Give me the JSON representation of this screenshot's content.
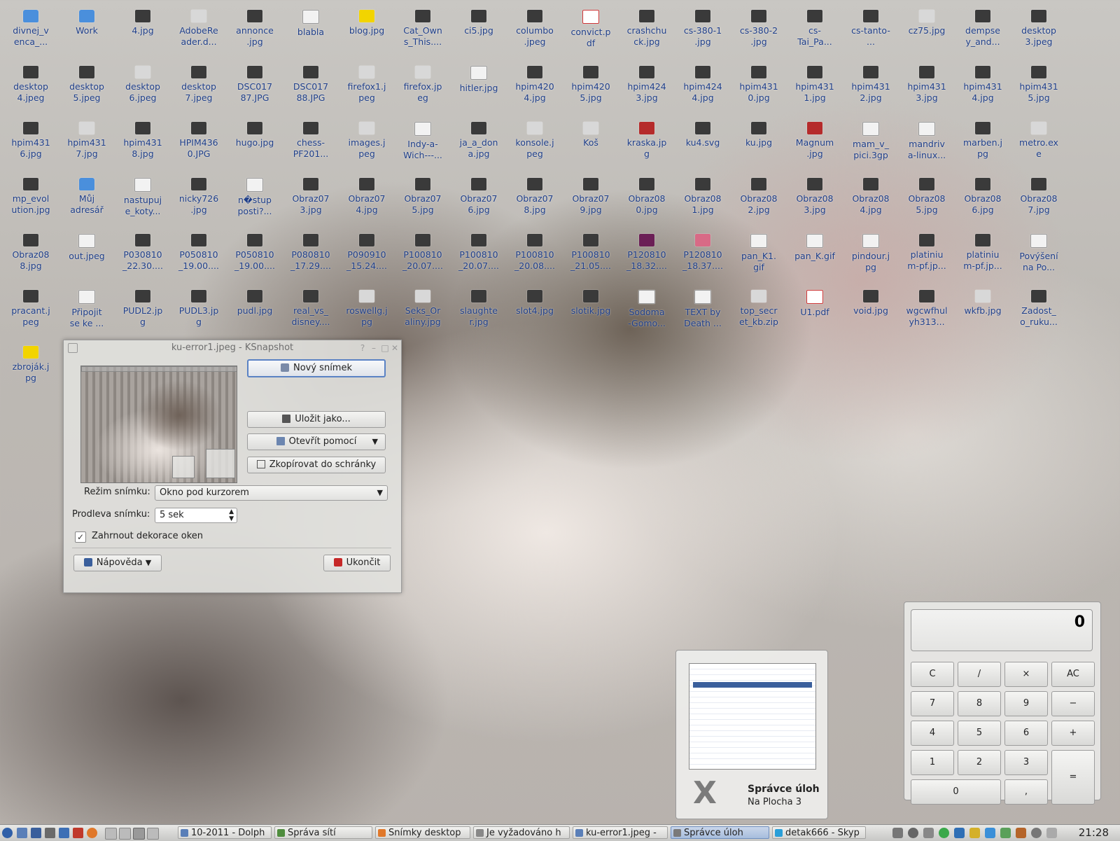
{
  "desktop_icons": [
    {
      "label": "divnej_v\nenca_...",
      "col": 0,
      "row": 0,
      "kind": "g-folder"
    },
    {
      "label": "Work",
      "col": 1,
      "row": 0,
      "kind": "g-folder"
    },
    {
      "label": "4.jpg",
      "col": 2,
      "row": 0,
      "kind": ""
    },
    {
      "label": "AdobeRe\nader.d...",
      "col": 3,
      "row": 0,
      "kind": "g-light"
    },
    {
      "label": "annonce\n.jpg",
      "col": 4,
      "row": 0,
      "kind": ""
    },
    {
      "label": "blabla",
      "col": 5,
      "row": 0,
      "kind": "g-doc"
    },
    {
      "label": "blog.jpg",
      "col": 6,
      "row": 0,
      "kind": "g-yellow"
    },
    {
      "label": "Cat_Own\ns_This....",
      "col": 7,
      "row": 0,
      "kind": ""
    },
    {
      "label": "ci5.jpg",
      "col": 8,
      "row": 0,
      "kind": ""
    },
    {
      "label": "columbo\n.jpeg",
      "col": 9,
      "row": 0,
      "kind": ""
    },
    {
      "label": "convict.p\ndf",
      "col": 10,
      "row": 0,
      "kind": "g-pdf"
    },
    {
      "label": "crashchu\nck.jpg",
      "col": 11,
      "row": 0,
      "kind": ""
    },
    {
      "label": "cs-380-1\n.jpg",
      "col": 12,
      "row": 0,
      "kind": ""
    },
    {
      "label": "cs-380-2\n.jpg",
      "col": 13,
      "row": 0,
      "kind": ""
    },
    {
      "label": "cs-\nTai_Pa...",
      "col": 14,
      "row": 0,
      "kind": ""
    },
    {
      "label": "cs-tanto-\n...",
      "col": 15,
      "row": 0,
      "kind": ""
    },
    {
      "label": "cz75.jpg",
      "col": 16,
      "row": 0,
      "kind": "g-light"
    },
    {
      "label": "dempse\ny_and...",
      "col": 17,
      "row": 0,
      "kind": ""
    },
    {
      "label": "desktop\n3.jpeg",
      "col": 18,
      "row": 0,
      "kind": ""
    },
    {
      "label": "desktop\n4.jpeg",
      "col": 0,
      "row": 1,
      "kind": ""
    },
    {
      "label": "desktop\n5.jpeg",
      "col": 1,
      "row": 1,
      "kind": ""
    },
    {
      "label": "desktop\n6.jpeg",
      "col": 2,
      "row": 1,
      "kind": "g-light"
    },
    {
      "label": "desktop\n7.jpeg",
      "col": 3,
      "row": 1,
      "kind": ""
    },
    {
      "label": "DSC017\n87.JPG",
      "col": 4,
      "row": 1,
      "kind": ""
    },
    {
      "label": "DSC017\n88.JPG",
      "col": 5,
      "row": 1,
      "kind": ""
    },
    {
      "label": "firefox1.j\npeg",
      "col": 6,
      "row": 1,
      "kind": "g-light"
    },
    {
      "label": "firefox.jp\neg",
      "col": 7,
      "row": 1,
      "kind": "g-light"
    },
    {
      "label": "hitler.jpg",
      "col": 8,
      "row": 1,
      "kind": "g-doc"
    },
    {
      "label": "hpim420\n4.jpg",
      "col": 9,
      "row": 1,
      "kind": ""
    },
    {
      "label": "hpim420\n5.jpg",
      "col": 10,
      "row": 1,
      "kind": ""
    },
    {
      "label": "hpim424\n3.jpg",
      "col": 11,
      "row": 1,
      "kind": ""
    },
    {
      "label": "hpim424\n4.jpg",
      "col": 12,
      "row": 1,
      "kind": ""
    },
    {
      "label": "hpim431\n0.jpg",
      "col": 13,
      "row": 1,
      "kind": ""
    },
    {
      "label": "hpim431\n1.jpg",
      "col": 14,
      "row": 1,
      "kind": ""
    },
    {
      "label": "hpim431\n2.jpg",
      "col": 15,
      "row": 1,
      "kind": ""
    },
    {
      "label": "hpim431\n3.jpg",
      "col": 16,
      "row": 1,
      "kind": ""
    },
    {
      "label": "hpim431\n4.jpg",
      "col": 17,
      "row": 1,
      "kind": ""
    },
    {
      "label": "hpim431\n5.jpg",
      "col": 18,
      "row": 1,
      "kind": ""
    },
    {
      "label": "hpim431\n6.jpg",
      "col": 0,
      "row": 2,
      "kind": ""
    },
    {
      "label": "hpim431\n7.jpg",
      "col": 1,
      "row": 2,
      "kind": "g-light"
    },
    {
      "label": "hpim431\n8.jpg",
      "col": 2,
      "row": 2,
      "kind": ""
    },
    {
      "label": "HPIM436\n0.JPG",
      "col": 3,
      "row": 2,
      "kind": ""
    },
    {
      "label": "hugo.jpg",
      "col": 4,
      "row": 2,
      "kind": ""
    },
    {
      "label": "chess-\nPF201...",
      "col": 5,
      "row": 2,
      "kind": ""
    },
    {
      "label": "images.j\npeg",
      "col": 6,
      "row": 2,
      "kind": "g-light"
    },
    {
      "label": "Indy-a-\nWich---...",
      "col": 7,
      "row": 2,
      "kind": "g-doc"
    },
    {
      "label": "ja_a_don\na.jpg",
      "col": 8,
      "row": 2,
      "kind": ""
    },
    {
      "label": "konsole.j\npeg",
      "col": 9,
      "row": 2,
      "kind": "g-light"
    },
    {
      "label": "Koš",
      "col": 10,
      "row": 2,
      "kind": "g-light"
    },
    {
      "label": "kraska.jp\ng",
      "col": 11,
      "row": 2,
      "kind": "g-red"
    },
    {
      "label": "ku4.svg",
      "col": 12,
      "row": 2,
      "kind": ""
    },
    {
      "label": "ku.jpg",
      "col": 13,
      "row": 2,
      "kind": ""
    },
    {
      "label": "Magnum\n.jpg",
      "col": 14,
      "row": 2,
      "kind": "g-red"
    },
    {
      "label": "mam_v_\npici.3gp",
      "col": 15,
      "row": 2,
      "kind": "g-doc"
    },
    {
      "label": "mandriv\na-linux...",
      "col": 16,
      "row": 2,
      "kind": "g-doc"
    },
    {
      "label": "marben.j\npg",
      "col": 17,
      "row": 2,
      "kind": ""
    },
    {
      "label": "metro.ex\ne",
      "col": 18,
      "row": 2,
      "kind": "g-light"
    },
    {
      "label": "mp_evol\nution.jpg",
      "col": 0,
      "row": 3,
      "kind": ""
    },
    {
      "label": "Můj\nadresář",
      "col": 1,
      "row": 3,
      "kind": "g-folder"
    },
    {
      "label": "nastupuj\ne_koty...",
      "col": 2,
      "row": 3,
      "kind": "g-doc"
    },
    {
      "label": "nicky726\n.jpg",
      "col": 3,
      "row": 3,
      "kind": ""
    },
    {
      "label": "n�stup\nposti?...",
      "col": 4,
      "row": 3,
      "kind": "g-doc"
    },
    {
      "label": "Obraz07\n3.jpg",
      "col": 5,
      "row": 3,
      "kind": ""
    },
    {
      "label": "Obraz07\n4.jpg",
      "col": 6,
      "row": 3,
      "kind": ""
    },
    {
      "label": "Obraz07\n5.jpg",
      "col": 7,
      "row": 3,
      "kind": ""
    },
    {
      "label": "Obraz07\n6.jpg",
      "col": 8,
      "row": 3,
      "kind": ""
    },
    {
      "label": "Obraz07\n8.jpg",
      "col": 9,
      "row": 3,
      "kind": ""
    },
    {
      "label": "Obraz07\n9.jpg",
      "col": 10,
      "row": 3,
      "kind": ""
    },
    {
      "label": "Obraz08\n0.jpg",
      "col": 11,
      "row": 3,
      "kind": ""
    },
    {
      "label": "Obraz08\n1.jpg",
      "col": 12,
      "row": 3,
      "kind": ""
    },
    {
      "label": "Obraz08\n2.jpg",
      "col": 13,
      "row": 3,
      "kind": ""
    },
    {
      "label": "Obraz08\n3.jpg",
      "col": 14,
      "row": 3,
      "kind": ""
    },
    {
      "label": "Obraz08\n4.jpg",
      "col": 15,
      "row": 3,
      "kind": ""
    },
    {
      "label": "Obraz08\n5.jpg",
      "col": 16,
      "row": 3,
      "kind": ""
    },
    {
      "label": "Obraz08\n6.jpg",
      "col": 17,
      "row": 3,
      "kind": ""
    },
    {
      "label": "Obraz08\n7.jpg",
      "col": 18,
      "row": 3,
      "kind": ""
    },
    {
      "label": "Obraz08\n8.jpg",
      "col": 0,
      "row": 4,
      "kind": ""
    },
    {
      "label": "out.jpeg",
      "col": 1,
      "row": 4,
      "kind": "g-doc"
    },
    {
      "label": "P030810\n_22.30....",
      "col": 2,
      "row": 4,
      "kind": ""
    },
    {
      "label": "P050810\n_19.00....",
      "col": 3,
      "row": 4,
      "kind": ""
    },
    {
      "label": "P050810\n_19.00....",
      "col": 4,
      "row": 4,
      "kind": ""
    },
    {
      "label": "P080810\n_17.29....",
      "col": 5,
      "row": 4,
      "kind": ""
    },
    {
      "label": "P090910\n_15.24....",
      "col": 6,
      "row": 4,
      "kind": ""
    },
    {
      "label": "P100810\n_20.07....",
      "col": 7,
      "row": 4,
      "kind": ""
    },
    {
      "label": "P100810\n_20.07....",
      "col": 8,
      "row": 4,
      "kind": ""
    },
    {
      "label": "P100810\n_20.08....",
      "col": 9,
      "row": 4,
      "kind": ""
    },
    {
      "label": "P100810\n_21.05....",
      "col": 10,
      "row": 4,
      "kind": ""
    },
    {
      "label": "P120810\n_18.32....",
      "col": 11,
      "row": 4,
      "kind": "g-purple"
    },
    {
      "label": "P120810\n_18.37....",
      "col": 12,
      "row": 4,
      "kind": "g-pink"
    },
    {
      "label": "pan_K1.\ngif",
      "col": 13,
      "row": 4,
      "kind": "g-doc"
    },
    {
      "label": "pan_K.gif",
      "col": 14,
      "row": 4,
      "kind": "g-doc"
    },
    {
      "label": "pindour.j\npg",
      "col": 15,
      "row": 4,
      "kind": "g-doc"
    },
    {
      "label": "platiniu\nm-pf.jp...",
      "col": 16,
      "row": 4,
      "kind": ""
    },
    {
      "label": "platiniu\nm-pf.jp...",
      "col": 17,
      "row": 4,
      "kind": ""
    },
    {
      "label": "Povýšení\nna Po...",
      "col": 18,
      "row": 4,
      "kind": "g-doc"
    },
    {
      "label": "pracant.j\npeg",
      "col": 0,
      "row": 5,
      "kind": ""
    },
    {
      "label": "Připojit\nse ke ...",
      "col": 1,
      "row": 5,
      "kind": "g-doc"
    },
    {
      "label": "PUDL2.jp\ng",
      "col": 2,
      "row": 5,
      "kind": ""
    },
    {
      "label": "PUDL3.jp\ng",
      "col": 3,
      "row": 5,
      "kind": ""
    },
    {
      "label": "pudl.jpg",
      "col": 4,
      "row": 5,
      "kind": ""
    },
    {
      "label": "real_vs_\ndisney....",
      "col": 5,
      "row": 5,
      "kind": ""
    },
    {
      "label": "roswellg.j\npg",
      "col": 6,
      "row": 5,
      "kind": "g-light"
    },
    {
      "label": "Seks_Or\naliny.jpg",
      "col": 7,
      "row": 5,
      "kind": "g-light"
    },
    {
      "label": "slaughte\nr.jpg",
      "col": 8,
      "row": 5,
      "kind": ""
    },
    {
      "label": "slot4.jpg",
      "col": 9,
      "row": 5,
      "kind": ""
    },
    {
      "label": "slotik.jpg",
      "col": 10,
      "row": 5,
      "kind": ""
    },
    {
      "label": "Sodoma\n-Gomo...",
      "col": 11,
      "row": 5,
      "kind": "g-doc"
    },
    {
      "label": "TEXT by\nDeath ...",
      "col": 12,
      "row": 5,
      "kind": "g-doc"
    },
    {
      "label": "top_secr\net_kb.zip",
      "col": 13,
      "row": 5,
      "kind": "g-light"
    },
    {
      "label": "U1.pdf",
      "col": 14,
      "row": 5,
      "kind": "g-pdf"
    },
    {
      "label": "void.jpg",
      "col": 15,
      "row": 5,
      "kind": ""
    },
    {
      "label": "wgcwfhul\nyh313...",
      "col": 16,
      "row": 5,
      "kind": ""
    },
    {
      "label": "wkfb.jpg",
      "col": 17,
      "row": 5,
      "kind": "g-light"
    },
    {
      "label": "Zadost_\no_ruku...",
      "col": 18,
      "row": 5,
      "kind": ""
    },
    {
      "label": "zbroják.j\npg",
      "col": 0,
      "row": 6,
      "kind": "g-yellow"
    }
  ],
  "ksnapshot": {
    "title": "ku-error1.jpeg - KSnapshot",
    "new_snapshot": "Nový snímek",
    "save_as": "Uložit jako...",
    "open_with": "Otevřít pomocí",
    "copy_clipboard": "Zkopírovat do schránky",
    "mode_label": "Režim snímku:",
    "mode_value": "Okno pod kurzorem",
    "delay_label": "Prodleva snímku:",
    "delay_value": "5 sek",
    "include_decorations": "Zahrnout dekorace oken",
    "include_decorations_checked": true,
    "help": "Nápověda",
    "quit": "Ukončit"
  },
  "calculator": {
    "display": "0",
    "keys": [
      [
        "C",
        "/",
        "×",
        "AC"
      ],
      [
        "7",
        "8",
        "9",
        "−"
      ],
      [
        "4",
        "5",
        "6",
        "+"
      ],
      [
        "1",
        "2",
        "3",
        "="
      ],
      [
        "0",
        ","
      ]
    ]
  },
  "task_switcher": {
    "title": "Správce úloh",
    "subtitle": "Na Plocha 3"
  },
  "taskbar": {
    "tasks": [
      {
        "label": "10-2011 - Dolph",
        "active": false,
        "icon_color": "#5a7fb8"
      },
      {
        "label": "Správa sítí",
        "active": false,
        "icon_color": "#4f8d3e"
      },
      {
        "label": "Snímky desktop",
        "active": false,
        "icon_color": "#e0782a"
      },
      {
        "label": "Je vyžadováno h",
        "active": false,
        "icon_color": "#888888"
      },
      {
        "label": "ku-error1.jpeg -",
        "active": false,
        "icon_color": "#5a7fb8"
      },
      {
        "label": "Správce úloh",
        "active": true,
        "icon_color": "#7a7a7a"
      },
      {
        "label": "detak666 - Skyp",
        "active": false,
        "icon_color": "#2a9fd8"
      }
    ],
    "clock": "21:28"
  }
}
